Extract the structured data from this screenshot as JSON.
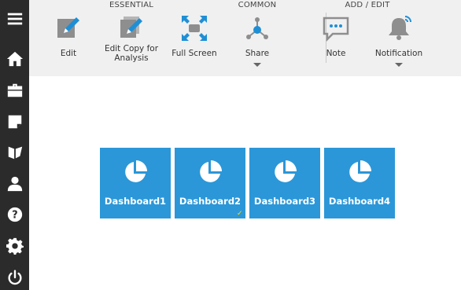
{
  "sidebar": {
    "items": [
      {
        "name": "menu",
        "icon": "hamburger-icon"
      },
      {
        "name": "home",
        "icon": "home-icon"
      },
      {
        "name": "open",
        "icon": "briefcase-icon"
      },
      {
        "name": "notes",
        "icon": "note-icon"
      },
      {
        "name": "folder",
        "icon": "folder-icon"
      },
      {
        "name": "account",
        "icon": "user-icon"
      },
      {
        "name": "help",
        "icon": "help-icon"
      },
      {
        "name": "settings",
        "icon": "gear-icon"
      },
      {
        "name": "logout",
        "icon": "power-icon"
      }
    ]
  },
  "ribbon": {
    "groups": {
      "essential": "ESSENTIAL",
      "common": "COMMON",
      "add_edit": "ADD / EDIT"
    },
    "tools": {
      "edit": "Edit",
      "edit_copy": "Edit Copy for Analysis",
      "full_screen": "Full Screen",
      "share": "Share",
      "note": "Note",
      "notification": "Notification"
    }
  },
  "dashboards": [
    {
      "title": "Dashboard1",
      "selected": false
    },
    {
      "title": "Dashboard2",
      "selected": true,
      "marker": "✓"
    },
    {
      "title": "Dashboard3",
      "selected": false
    },
    {
      "title": "Dashboard4",
      "selected": false
    }
  ],
  "colors": {
    "sidebar_bg": "#2b2b2b",
    "ribbon_bg": "#f0f0f0",
    "tile_bg": "#2b97d8",
    "accent": "#1f8fd5"
  }
}
